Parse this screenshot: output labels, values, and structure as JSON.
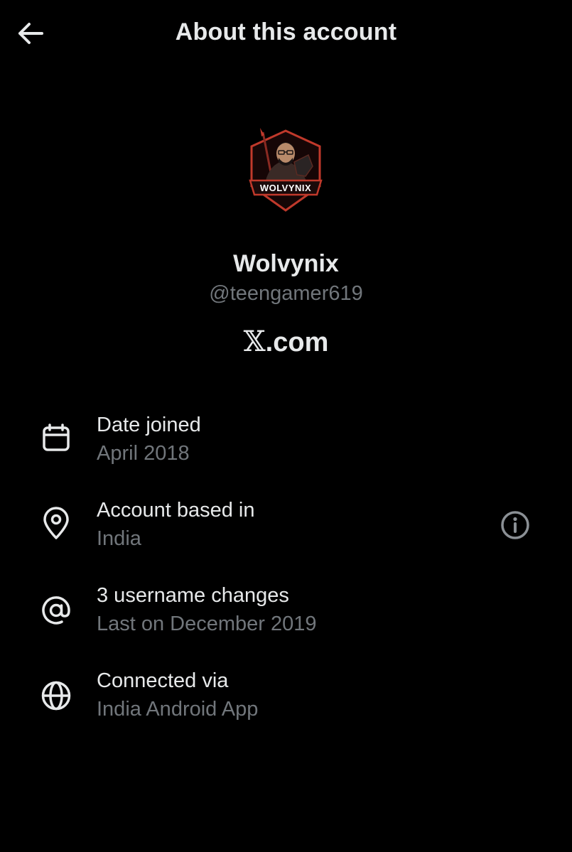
{
  "header": {
    "title": "About this account",
    "back_icon": "arrow-left-icon"
  },
  "profile": {
    "logo_text": "WOLVYNIX",
    "name": "Wolvynix",
    "handle": "@teengamer619",
    "brand_x": "𝕏",
    "brand_suffix": ".com"
  },
  "info_rows": [
    {
      "icon": "calendar-icon",
      "title": "Date joined",
      "value": "April 2018"
    },
    {
      "icon": "location-pin-icon",
      "title": "Account based in",
      "value": "India",
      "detail_icon": "info-circle-icon"
    },
    {
      "icon": "at-sign-icon",
      "title": "3 username changes",
      "value": "Last on December 2019"
    },
    {
      "icon": "globe-icon",
      "title": "Connected via",
      "value": "India Android App"
    }
  ],
  "colors": {
    "background": "#000000",
    "primary_text": "#e7e9ea",
    "secondary_text": "#71767b",
    "logo_accent": "#c0392b"
  }
}
